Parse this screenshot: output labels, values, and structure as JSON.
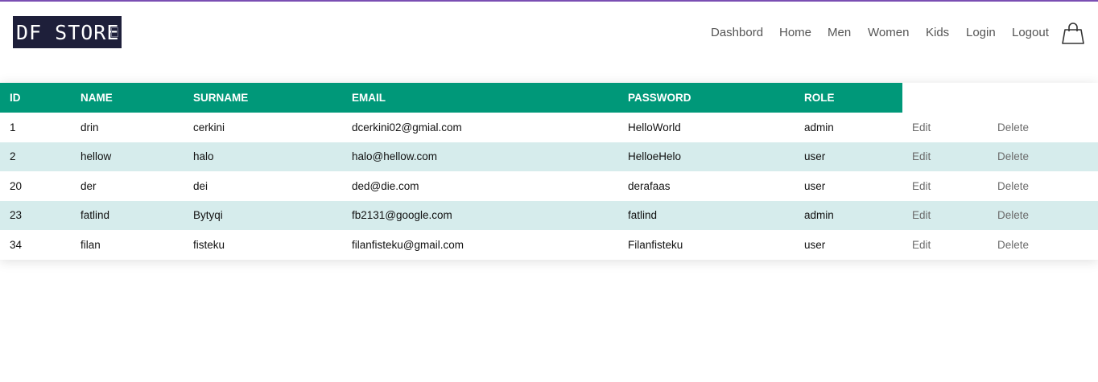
{
  "brand": {
    "logo_text": "DF STORE"
  },
  "nav": {
    "dashbord": "Dashbord",
    "home": "Home",
    "men": "Men",
    "women": "Women",
    "kids": "Kids",
    "login": "Login",
    "logout": "Logout",
    "cart_icon": "shopping-bag-icon"
  },
  "table": {
    "headers": [
      "ID",
      "NAME",
      "SURNAME",
      "EMAIL",
      "PASSWORD",
      "ROLE"
    ],
    "rows": [
      {
        "id": "1",
        "name": "drin",
        "surname": "cerkini",
        "email": "dcerkini02@gmial.com",
        "password": "HelloWorld",
        "role": "admin",
        "edit": "Edit",
        "delete": "Delete"
      },
      {
        "id": "2",
        "name": "hellow",
        "surname": "halo",
        "email": "halo@hellow.com",
        "password": "HelloeHelo",
        "role": "user",
        "edit": "Edit",
        "delete": "Delete"
      },
      {
        "id": "20",
        "name": "der",
        "surname": "dei",
        "email": "ded@die.com",
        "password": "derafaas",
        "role": "user",
        "edit": "Edit",
        "delete": "Delete"
      },
      {
        "id": "23",
        "name": "fatlind",
        "surname": "Bytyqi",
        "email": "fb2131@google.com",
        "password": "fatlind",
        "role": "admin",
        "edit": "Edit",
        "delete": "Delete"
      },
      {
        "id": "34",
        "name": "filan",
        "surname": "fisteku",
        "email": "filanfisteku@gmail.com",
        "password": "Filanfisteku",
        "role": "user",
        "edit": "Edit",
        "delete": "Delete"
      }
    ]
  },
  "colors": {
    "header_bg": "#009879",
    "alt_row_bg": "#d6ecec",
    "top_border": "#7a4fb3",
    "logo_bg": "#1e1f3a"
  }
}
